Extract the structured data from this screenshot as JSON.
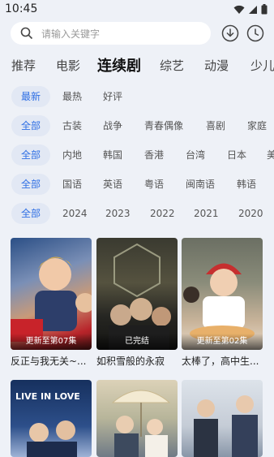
{
  "status": {
    "time": "10:45"
  },
  "search": {
    "placeholder": "请输入关键字"
  },
  "categories": [
    "推荐",
    "电影",
    "连续剧",
    "综艺",
    "动漫",
    "少儿"
  ],
  "filters": {
    "sort": [
      "最新",
      "最热",
      "好评"
    ],
    "genre": [
      "全部",
      "古装",
      "战争",
      "青春偶像",
      "喜剧",
      "家庭"
    ],
    "region": [
      "全部",
      "内地",
      "韩国",
      "香港",
      "台湾",
      "日本",
      "美"
    ],
    "language": [
      "全部",
      "国语",
      "英语",
      "粤语",
      "闽南语",
      "韩语"
    ],
    "year": [
      "全部",
      "2024",
      "2023",
      "2022",
      "2021",
      "2020"
    ]
  },
  "cards": [
    {
      "badge": "更新至第07集",
      "title": "反正与我无关~..."
    },
    {
      "badge": "已完结",
      "title": "如积雪般的永寂"
    },
    {
      "badge": "更新至第02集",
      "title": "太棒了，高中生..."
    }
  ],
  "row2": [
    {
      "poster_text": "LIVE IN LOVE"
    },
    {
      "poster_text": ""
    },
    {
      "poster_text": ""
    }
  ],
  "colors": {
    "accent": "#2f6fe4",
    "chip_bg": "#e2e8f4",
    "background": "#eef1f7"
  }
}
